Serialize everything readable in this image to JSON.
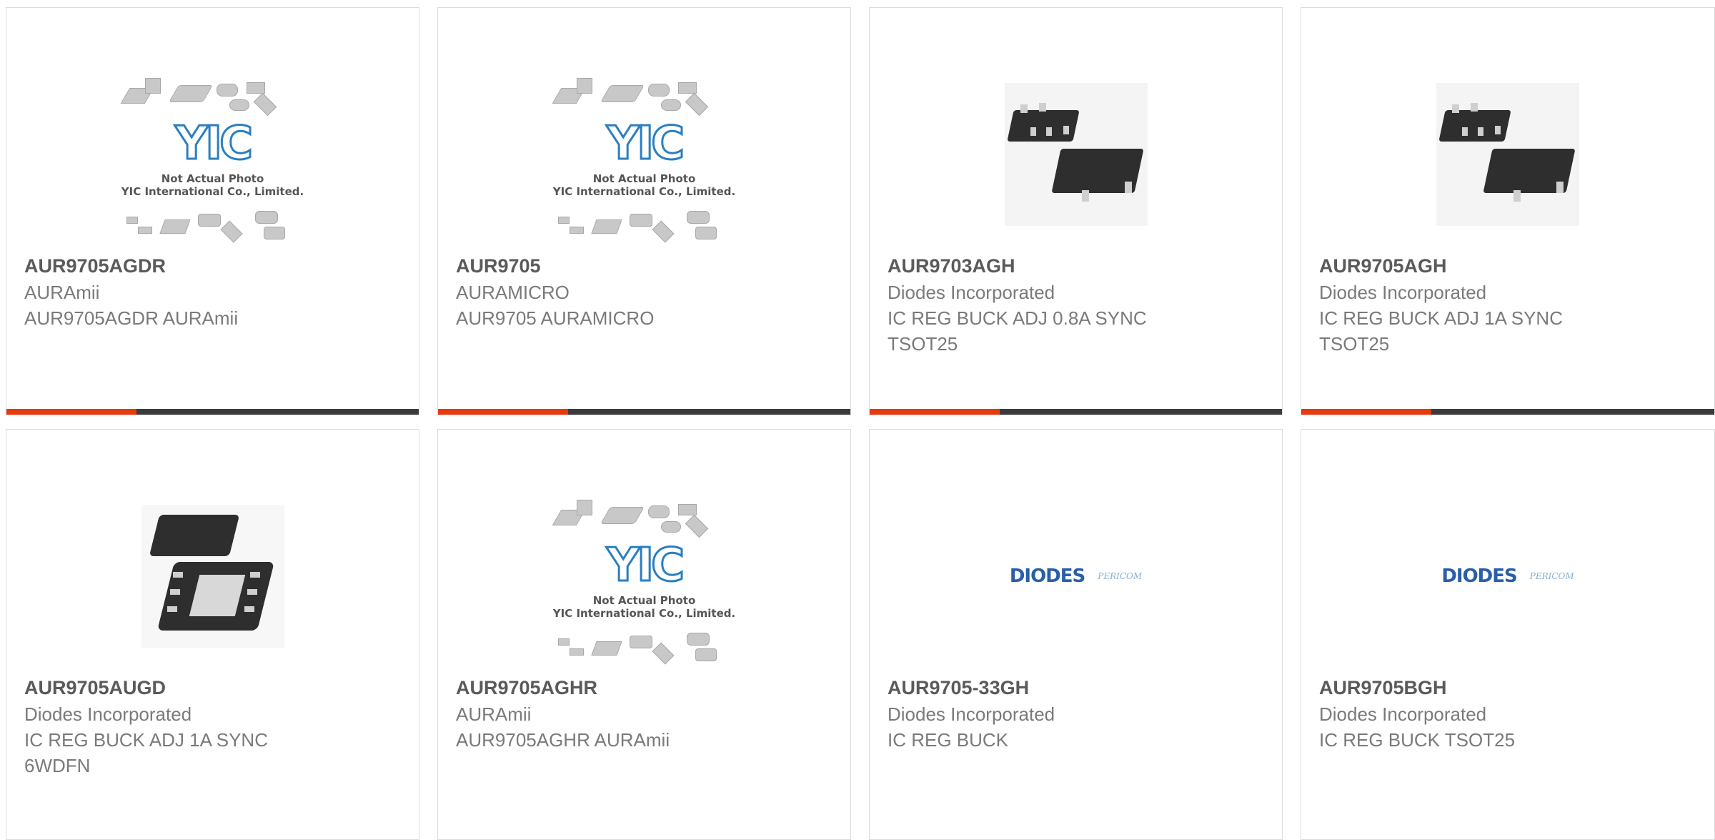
{
  "cards": [
    {
      "part": "AUR9705AGDR",
      "manufacturer": "AURAmii",
      "description": "AUR9705AGDR AURAmii",
      "image": "not-actual-photo"
    },
    {
      "part": "AUR9705",
      "manufacturer": "AURAMICRO",
      "description": "AUR9705 AURAMICRO",
      "image": "not-actual-photo"
    },
    {
      "part": "AUR9703AGH",
      "manufacturer": "Diodes Incorporated",
      "description": "IC REG BUCK ADJ 0.8A SYNC TSOT25",
      "image": "sot-package"
    },
    {
      "part": "AUR9705AGH",
      "manufacturer": "Diodes Incorporated",
      "description": "IC REG BUCK ADJ 1A SYNC TSOT25",
      "image": "sot-package"
    },
    {
      "part": "AUR9705AUGD",
      "manufacturer": "Diodes Incorporated",
      "description": "IC REG BUCK ADJ 1A SYNC 6WDFN",
      "image": "dfn-package"
    },
    {
      "part": "AUR9705AGHR",
      "manufacturer": "AURAmii",
      "description": "AUR9705AGHR AURAmii",
      "image": "not-actual-photo"
    },
    {
      "part": "AUR9705-33GH",
      "manufacturer": "Diodes Incorporated",
      "description": "IC REG BUCK",
      "image": "diodes-logo"
    },
    {
      "part": "AUR9705BGH",
      "manufacturer": "Diodes Incorporated",
      "description": "IC REG BUCK TSOT25",
      "image": "diodes-logo"
    }
  ],
  "placeholder": {
    "logo_text": "YIC",
    "line1": "Not Actual Photo",
    "line2": "YIC International Co., Limited."
  },
  "logos": {
    "diodes": "DIODES",
    "pericom": "PERICOM"
  },
  "colors": {
    "accent": "#e8380d",
    "bar": "#3b3b3b",
    "part_text": "#5a5a5a",
    "body_text": "#7a7a7a"
  }
}
